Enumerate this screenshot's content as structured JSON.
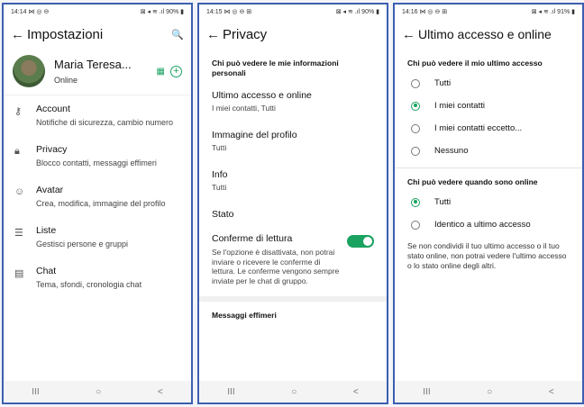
{
  "screen1": {
    "status": {
      "time": "14:14 ⋈ ◎ ⊖",
      "right": "⊠ ◂ ≋ .ıl 90% ▮"
    },
    "title": "Impostazioni",
    "profile": {
      "name": "Maria Teresa...",
      "status": "Online"
    },
    "items": [
      {
        "title": "Account",
        "sub": "Notifiche di sicurezza, cambio numero",
        "icon": "key-icon"
      },
      {
        "title": "Privacy",
        "sub": "Blocco contatti, messaggi effimeri",
        "icon": "lock-icon"
      },
      {
        "title": "Avatar",
        "sub": "Crea, modifica, immagine del profilo",
        "icon": "avatar-icon"
      },
      {
        "title": "Liste",
        "sub": "Gestisci persone e gruppi",
        "icon": "list-icon"
      },
      {
        "title": "Chat",
        "sub": "Tema, sfondi, cronologia chat",
        "icon": "chat-icon"
      }
    ]
  },
  "screen2": {
    "status": {
      "time": "14:15 ⋈ ◎ ⊖ ⊞",
      "right": "⊠ ◂ ≋ .ıl 90% ▮"
    },
    "title": "Privacy",
    "section": "Chi può vedere le mie informazioni personali",
    "items": [
      {
        "title": "Ultimo accesso e online",
        "sub": "I miei contatti, Tutti"
      },
      {
        "title": "Immagine del profilo",
        "sub": "Tutti"
      },
      {
        "title": "Info",
        "sub": "Tutti"
      },
      {
        "title": "Stato",
        "sub": ""
      }
    ],
    "read_receipts": {
      "title": "Conferme di lettura",
      "sub": "Se l'opzione è disattivata, non potrai inviare o ricevere le conferme di lettura. Le conferme vengono sempre inviate per le chat di gruppo.",
      "enabled": true
    },
    "section2": "Messaggi effimeri"
  },
  "screen3": {
    "status": {
      "time": "14:16 ⋈ ◎ ⊖ ⊞",
      "right": "⊠ ◂ ≋ .ıl 91% ▮"
    },
    "title": "Ultimo accesso e online",
    "section1": "Chi può vedere il mio ultimo accesso",
    "options1": [
      {
        "label": "Tutti",
        "selected": false
      },
      {
        "label": "I miei contatti",
        "selected": true
      },
      {
        "label": "I miei contatti eccetto...",
        "selected": false
      },
      {
        "label": "Nessuno",
        "selected": false
      }
    ],
    "section2": "Chi può vedere quando sono online",
    "options2": [
      {
        "label": "Tutti",
        "selected": true
      },
      {
        "label": "Identico a ultimo accesso",
        "selected": false
      }
    ],
    "note": "Se non condividi il tuo ultimo accesso o il tuo stato online, non potrai vedere l'ultimo accesso o lo stato online degli altri."
  },
  "nav": {
    "recents": "III",
    "home": "○",
    "back": "<"
  },
  "colors": {
    "accent": "#1aa260",
    "frame": "#3c5fb0"
  }
}
